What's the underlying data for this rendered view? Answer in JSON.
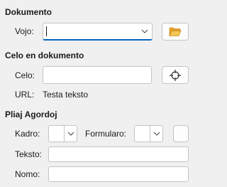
{
  "dokumento": {
    "heading": "Dokumento",
    "vojo_label": "Vojo:",
    "vojo_value": "",
    "icons": {
      "dropdown": "chevron-down-icon",
      "browse": "folder-open-icon"
    },
    "colors": {
      "folder": "#f0b43c",
      "focus": "#0067c0"
    }
  },
  "celo": {
    "heading": "Celo en dokumento",
    "celo_label": "Celo:",
    "celo_value": "",
    "url_label": "URL:",
    "url_value": "Testa teksto",
    "icons": {
      "target": "crosshair-icon"
    }
  },
  "agordoj": {
    "heading": "Pliaj Agordoj",
    "kadro_label": "Kadro:",
    "kadro_value": "",
    "formularo_label": "Formularo:",
    "formularo_value": "",
    "teksto_label": "Teksto:",
    "teksto_value": "",
    "nomo_label": "Nomo:",
    "nomo_value": ""
  }
}
